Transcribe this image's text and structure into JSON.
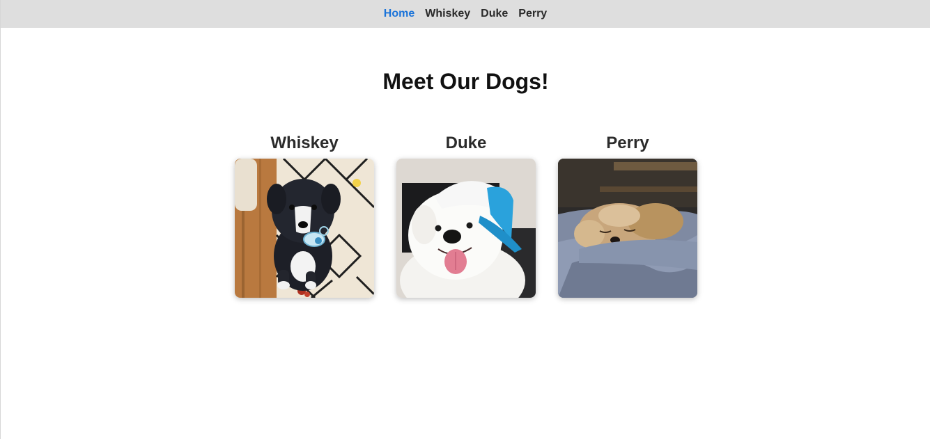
{
  "nav": {
    "items": [
      {
        "label": "Home",
        "active": true
      },
      {
        "label": "Whiskey",
        "active": false
      },
      {
        "label": "Duke",
        "active": false
      },
      {
        "label": "Perry",
        "active": false
      }
    ]
  },
  "main": {
    "title": "Meet Our Dogs!",
    "dogs": [
      {
        "name": "Whiskey"
      },
      {
        "name": "Duke"
      },
      {
        "name": "Perry"
      }
    ]
  },
  "colors": {
    "nav_background": "#dedede",
    "nav_active": "#1a73d9",
    "nav_text": "#2a2a2a",
    "title_text": "#111111"
  }
}
